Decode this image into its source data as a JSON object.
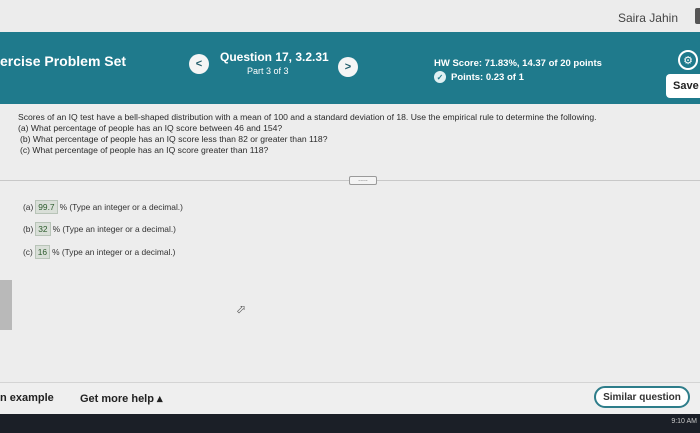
{
  "user": {
    "name": "Saira Jahin"
  },
  "header": {
    "set_title": "ercise Problem Set",
    "prev_label": "<",
    "next_label": ">",
    "question_title": "Question 17, 3.2.31",
    "question_part": "Part 3 of 3",
    "hw_score": "HW Score: 71.83%, 14.37 of 20 points",
    "points": "Points: 0.23 of 1",
    "save_label": "Save",
    "accent_color": "#1f7a8c"
  },
  "problem": {
    "intro": "Scores of an IQ test have a bell-shaped distribution with a mean of 100 and a standard deviation of 18. Use the empirical rule to determine the following.",
    "parts": [
      "(a) What percentage of people has an IQ score between 46 and 154?",
      "(b) What percentage of people has an IQ score less than 82 or greater than 118?",
      "(c) What percentage of people has an IQ score greater than 118?"
    ],
    "expand_label": "....."
  },
  "answers": [
    {
      "prefix": "(a)",
      "value": "99.7",
      "suffix": "% (Type an integer or a decimal.)"
    },
    {
      "prefix": "(b)",
      "value": "32",
      "suffix": "% (Type an integer or a decimal.)"
    },
    {
      "prefix": "(c)",
      "value": "16",
      "suffix": "% (Type an integer or a decimal.)"
    }
  ],
  "footer": {
    "help_example": "n example",
    "get_more_help": "Get more help ▴",
    "similar_question": "Similar question"
  },
  "taskbar": {
    "clock": "9:10 AM"
  },
  "icons": {
    "points": "check-circle-icon",
    "settings": "gear-icon",
    "cursor": "pointer-cursor-icon"
  }
}
